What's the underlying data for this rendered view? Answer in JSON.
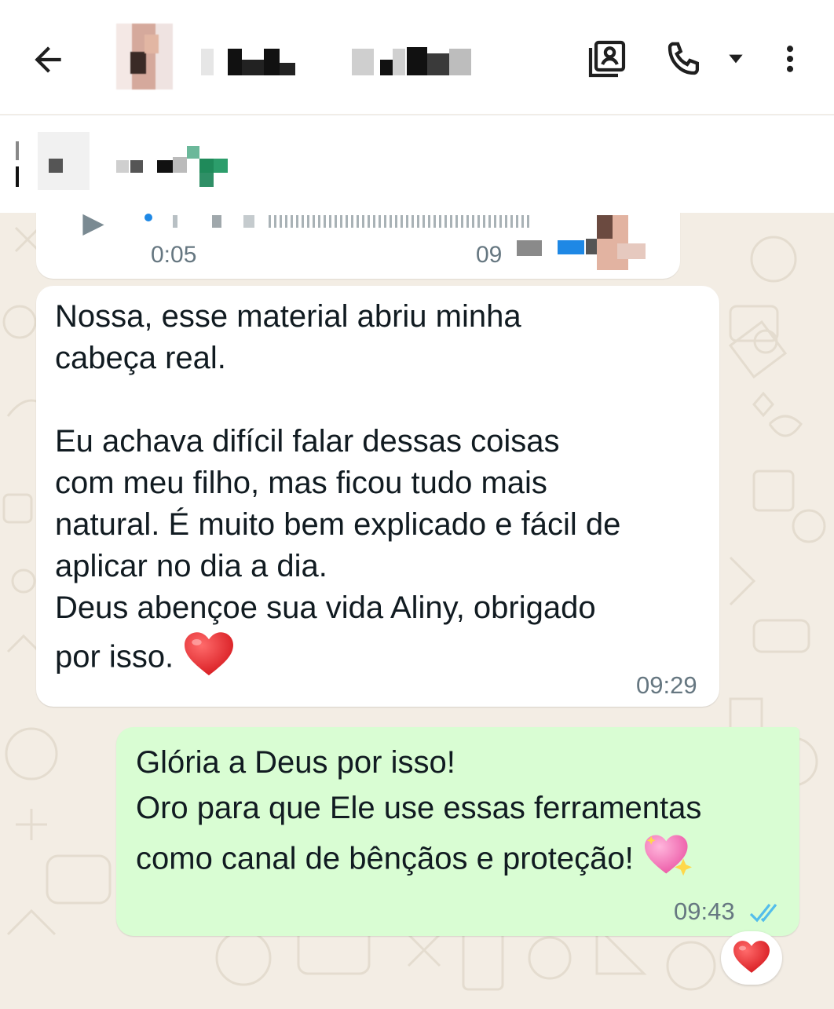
{
  "header": {
    "contact_name": "",
    "back_icon": "arrow-left-icon",
    "contact_card_icon": "contact-card-icon",
    "call_icon": "phone-icon",
    "call_menu_icon": "caret-down-icon",
    "more_icon": "more-vertical-icon"
  },
  "pinned": {
    "text": ""
  },
  "audio_message": {
    "duration": "0:05",
    "timestamp": "09"
  },
  "messages": [
    {
      "direction": "incoming",
      "text": "Nossa, esse material abriu minha\ncabeça real.\n\nEu achava difícil falar dessas coisas\ncom meu filho, mas ficou tudo mais\nnatural. É muito bem explicado e fácil de\naplicar no dia a dia.\nDeus abençoe sua vida Aliny, obrigado\npor isso.",
      "emoji": "red-heart",
      "time": "09:29"
    },
    {
      "direction": "outgoing",
      "text": "Glória a Deus por isso!\nOro para que Ele use essas ferramentas\ncomo canal de bênçãos e proteção!",
      "emoji": "sparkling-heart",
      "time": "09:43",
      "status_icon": "double-check-read-icon"
    }
  ],
  "reaction": {
    "emoji": "red-heart"
  },
  "colors": {
    "incoming_bubble": "#ffffff",
    "outgoing_bubble": "#d9fdd3",
    "wallpaper": "#f3ede4",
    "timestamp": "#667781",
    "read_ticks": "#53bdeb"
  }
}
